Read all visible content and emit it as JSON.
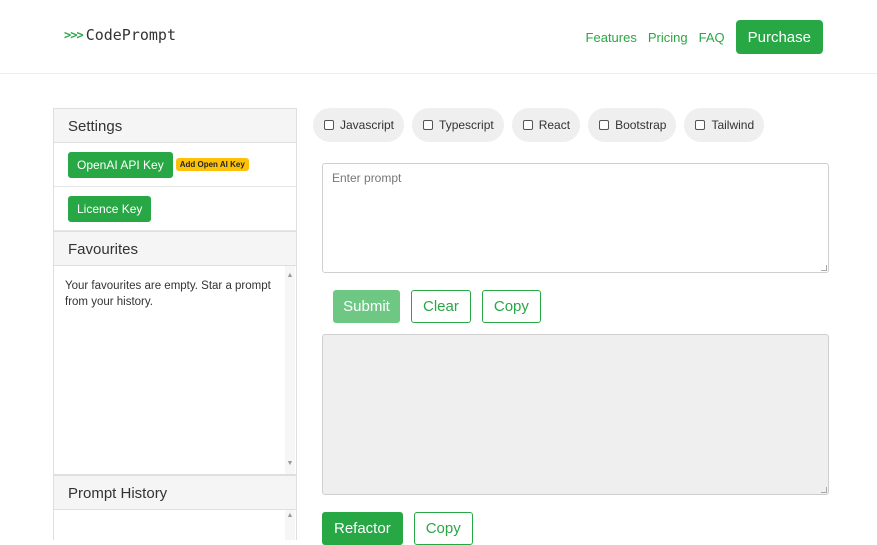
{
  "navbar": {
    "brand_arrows": ">>>",
    "brand_name": "CodePrompt",
    "links": [
      "Features",
      "Pricing",
      "FAQ"
    ],
    "purchase_label": "Purchase"
  },
  "sidebar": {
    "settings_title": "Settings",
    "openai_key_label": "OpenAI API Key",
    "add_key_badge": "Add Open AI Key",
    "licence_key_label": "Licence Key",
    "favourites_title": "Favourites",
    "favourites_empty_text": "Your favourites are empty. Star a prompt from your history.",
    "history_title": "Prompt History"
  },
  "tags": [
    "Javascript",
    "Typescript",
    "React",
    "Bootstrap",
    "Tailwind"
  ],
  "prompt": {
    "placeholder": "Enter prompt",
    "value": ""
  },
  "actions": {
    "submit_label": "Submit",
    "clear_label": "Clear",
    "copy_label": "Copy"
  },
  "output": {
    "value": ""
  },
  "bottom_actions": {
    "refactor_label": "Refactor",
    "copy_label": "Copy"
  },
  "colors": {
    "accent": "#28a745",
    "warning": "#ffc107"
  }
}
